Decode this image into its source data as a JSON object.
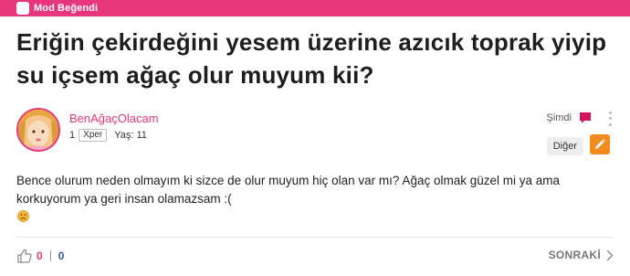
{
  "header": {
    "mod_badge_label": "Mod Beğendi"
  },
  "question": {
    "title": "Eriğin çekirdeğini yesem üzerine azıcık toprak yiyip su içsem ağaç olur muyum kii?",
    "body": "Bence olurum neden olmayım ki sizce de olur muyum hiç olan var mı? Ağaç olmak güzel mi ya ama korkuyorum ya geri insan olamazsam :("
  },
  "author": {
    "username": "BenAğaçOlacam",
    "level": "1",
    "rank": "Xper",
    "age": "Yaş: 11"
  },
  "actions": {
    "time": "Şimdi",
    "other_label": "Diğer"
  },
  "footer": {
    "upvotes": "0",
    "downvotes": "0",
    "next_label": "SONRAKİ"
  },
  "colors": {
    "brand": "#e8367a",
    "edit_button": "#f28a1d",
    "downvote": "#2b5ca8"
  },
  "icons": [
    "check-icon",
    "comment-icon",
    "more-vertical-icon",
    "edit-icon",
    "sad-face-emoji-icon",
    "thumbs-up-icon",
    "chevron-right-icon"
  ]
}
